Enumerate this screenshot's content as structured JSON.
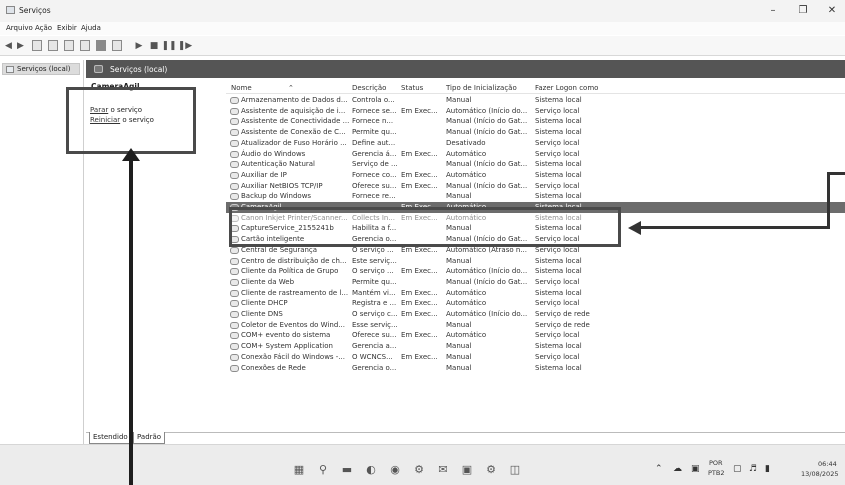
{
  "window": {
    "title": "Serviços"
  },
  "menu": [
    "Arquivo",
    "Ação",
    "Exibir",
    "Ajuda"
  ],
  "tree": {
    "root": "Serviços (local)"
  },
  "panel": {
    "header": "Serviços (local)",
    "selected_service": "CameraAgil"
  },
  "actions": {
    "stop_link": "Parar",
    "stop_suffix": " o serviço",
    "restart_link": "Reiniciar",
    "restart_suffix": " o serviço"
  },
  "columns": [
    "Nome",
    "Descrição",
    "Status",
    "Tipo de Inicialização",
    "Fazer Logon como"
  ],
  "rows": [
    {
      "name": "Armazenamento de Dados d...",
      "desc": "Controla o...",
      "status": "",
      "start": "Manual",
      "logon": "Sistema local"
    },
    {
      "name": "Assistente de aquisição de i...",
      "desc": "Fornece se...",
      "status": "Em Exec...",
      "start": "Automático (Início do...",
      "logon": "Serviço local"
    },
    {
      "name": "Assistente de Conectividade ...",
      "desc": "Fornece n...",
      "status": "",
      "start": "Manual (Início do Gat...",
      "logon": "Sistema local"
    },
    {
      "name": "Assistente de Conexão de C...",
      "desc": "Permite qu...",
      "status": "",
      "start": "Manual (Início do Gat...",
      "logon": "Sistema local"
    },
    {
      "name": "Atualizador de Fuso Horário ...",
      "desc": "Define aut...",
      "status": "",
      "start": "Desativado",
      "logon": "Serviço local"
    },
    {
      "name": "Áudio do Windows",
      "desc": "Gerencia á...",
      "status": "Em Exec...",
      "start": "Automático",
      "logon": "Serviço local"
    },
    {
      "name": "Autenticação Natural",
      "desc": "Serviço de ...",
      "status": "",
      "start": "Manual (Início do Gat...",
      "logon": "Sistema local"
    },
    {
      "name": "Auxiliar de IP",
      "desc": "Fornece co...",
      "status": "Em Exec...",
      "start": "Automático",
      "logon": "Sistema local"
    },
    {
      "name": "Auxiliar NetBIOS TCP/IP",
      "desc": "Oferece su...",
      "status": "Em Exec...",
      "start": "Manual (Início do Gat...",
      "logon": "Serviço local"
    },
    {
      "name": "Backup do Windows",
      "desc": "Fornece re...",
      "status": "",
      "start": "Manual",
      "logon": "Sistema local"
    },
    {
      "name": "CameraAgil",
      "desc": "",
      "status": "Em Exec...",
      "start": "Automático",
      "logon": "Sistema local",
      "selected": true
    },
    {
      "name": "Canon Inkjet Printer/Scanner...",
      "desc": "Collects In...",
      "status": "Em Exec...",
      "start": "Automático",
      "logon": "Sistema local",
      "faded": true
    },
    {
      "name": "CaptureService_2155241b",
      "desc": "Habilita a f...",
      "status": "",
      "start": "Manual",
      "logon": "Sistema local"
    },
    {
      "name": "Cartão inteligente",
      "desc": "Gerencia o...",
      "status": "",
      "start": "Manual (Início do Gat...",
      "logon": "Serviço local"
    },
    {
      "name": "Central de Segurança",
      "desc": "O serviço ...",
      "status": "Em Exec...",
      "start": "Automático (Atraso n...",
      "logon": "Serviço local"
    },
    {
      "name": "Centro de distribuição de ch...",
      "desc": "Este serviç...",
      "status": "",
      "start": "Manual",
      "logon": "Sistema local"
    },
    {
      "name": "Cliente da Política de Grupo",
      "desc": "O serviço ...",
      "status": "Em Exec...",
      "start": "Automático (Início do...",
      "logon": "Sistema local"
    },
    {
      "name": "Cliente da Web",
      "desc": "Permite qu...",
      "status": "",
      "start": "Manual (Início do Gat...",
      "logon": "Serviço local"
    },
    {
      "name": "Cliente de rastreamento de l...",
      "desc": "Mantém vi...",
      "status": "Em Exec...",
      "start": "Automático",
      "logon": "Sistema local"
    },
    {
      "name": "Cliente DHCP",
      "desc": "Registra e ...",
      "status": "Em Exec...",
      "start": "Automático",
      "logon": "Serviço local"
    },
    {
      "name": "Cliente DNS",
      "desc": "O serviço c...",
      "status": "Em Exec...",
      "start": "Automático (Início do...",
      "logon": "Serviço de rede"
    },
    {
      "name": "Coletor de Eventos do Wind...",
      "desc": "Esse serviç...",
      "status": "",
      "start": "Manual",
      "logon": "Serviço de rede"
    },
    {
      "name": "COM+ evento do sistema",
      "desc": "Oferece su...",
      "status": "Em Exec...",
      "start": "Automático",
      "logon": "Serviço local"
    },
    {
      "name": "COM+ System Application",
      "desc": "Gerencia a...",
      "status": "",
      "start": "Manual",
      "logon": "Sistema local"
    },
    {
      "name": "Conexão Fácil do Windows -...",
      "desc": "O WCNCS...",
      "status": "Em Exec...",
      "start": "Manual",
      "logon": "Serviço local"
    },
    {
      "name": "Conexões de Rede",
      "desc": "Gerencia o...",
      "status": "",
      "start": "Manual",
      "logon": "Sistema local"
    }
  ],
  "tabs": [
    "Estendido",
    "Padrão"
  ],
  "tray": {
    "lang": "POR",
    "layout": "PTB2",
    "time": "06:44",
    "date": "13/08/2025"
  },
  "colors": {
    "selected_row": "#6c6c6c",
    "panel_header": "#555555",
    "annotation": "#4a4a4a"
  }
}
